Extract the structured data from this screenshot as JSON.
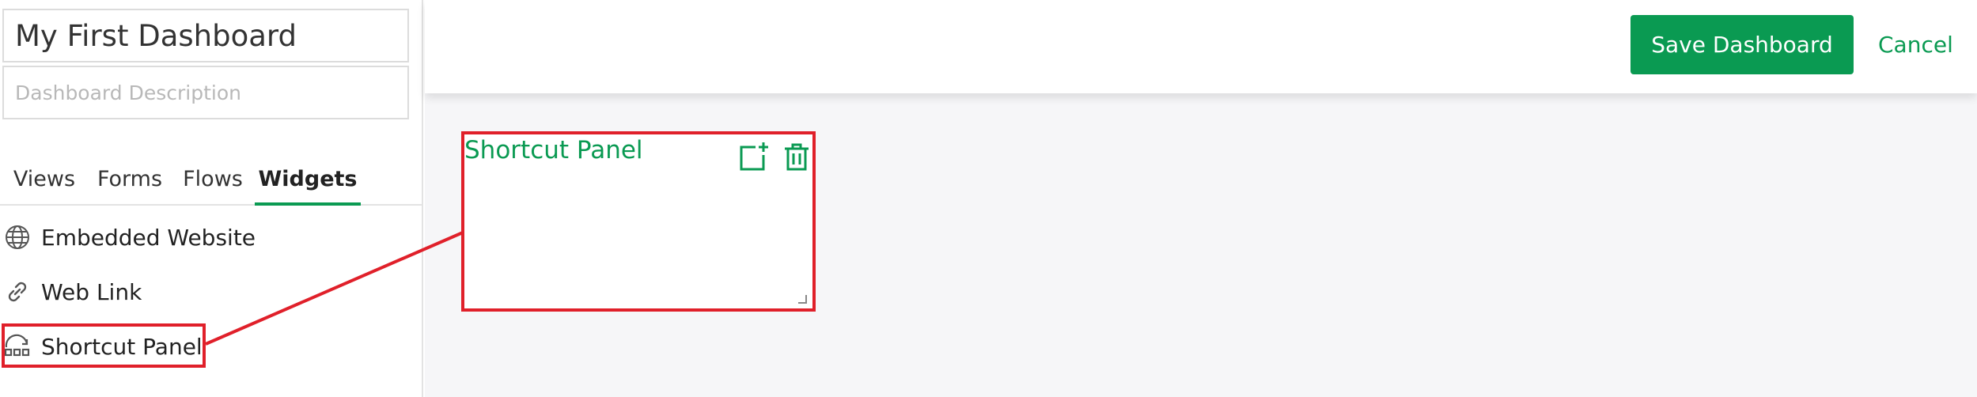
{
  "dashboard": {
    "title": "My First Dashboard",
    "description_placeholder": "Dashboard Description"
  },
  "tabs": [
    {
      "label": "Views",
      "active": false
    },
    {
      "label": "Forms",
      "active": false
    },
    {
      "label": "Flows",
      "active": false
    },
    {
      "label": "Widgets",
      "active": true
    }
  ],
  "widgets": [
    {
      "label": "Embedded Website",
      "icon": "globe-icon"
    },
    {
      "label": "Web Link",
      "icon": "link-icon"
    },
    {
      "label": "Shortcut Panel",
      "icon": "shortcut-panel-icon"
    }
  ],
  "toolbar": {
    "save_label": "Save Dashboard",
    "cancel_label": "Cancel"
  },
  "canvas": {
    "panel": {
      "title": "Shortcut Panel",
      "add_icon": "add-shortcut-icon",
      "delete_icon": "trash-icon"
    }
  },
  "colors": {
    "accent": "#0a9a52",
    "highlight": "#e0202a",
    "canvas_bg": "#f6f6f8"
  }
}
